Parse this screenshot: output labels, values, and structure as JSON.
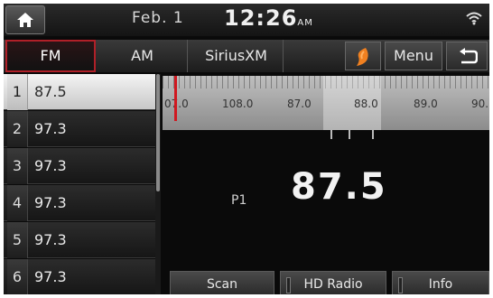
{
  "status": {
    "date": "Feb. 1",
    "time": "12:26",
    "ampm": "AM"
  },
  "tabs": {
    "fm": "FM",
    "am": "AM",
    "sirius": "SiriusXM",
    "menu": "Menu"
  },
  "presets": [
    {
      "num": "1",
      "freq": "87.5",
      "selected": true
    },
    {
      "num": "2",
      "freq": "97.3"
    },
    {
      "num": "3",
      "freq": "97.3"
    },
    {
      "num": "4",
      "freq": "97.3"
    },
    {
      "num": "5",
      "freq": "97.3"
    },
    {
      "num": "6",
      "freq": "97.3"
    }
  ],
  "dial": {
    "labels": [
      "07.0",
      "108.0",
      "87.0",
      "88.0",
      "89.0",
      "90."
    ]
  },
  "station": {
    "preset": "P1",
    "frequency": "87.5"
  },
  "buttons": {
    "scan": "Scan",
    "hd": "HD Radio",
    "info": "Info"
  },
  "colors": {
    "accent": "#b02028",
    "needle": "#d01820",
    "sound_icon": "#f08020"
  }
}
